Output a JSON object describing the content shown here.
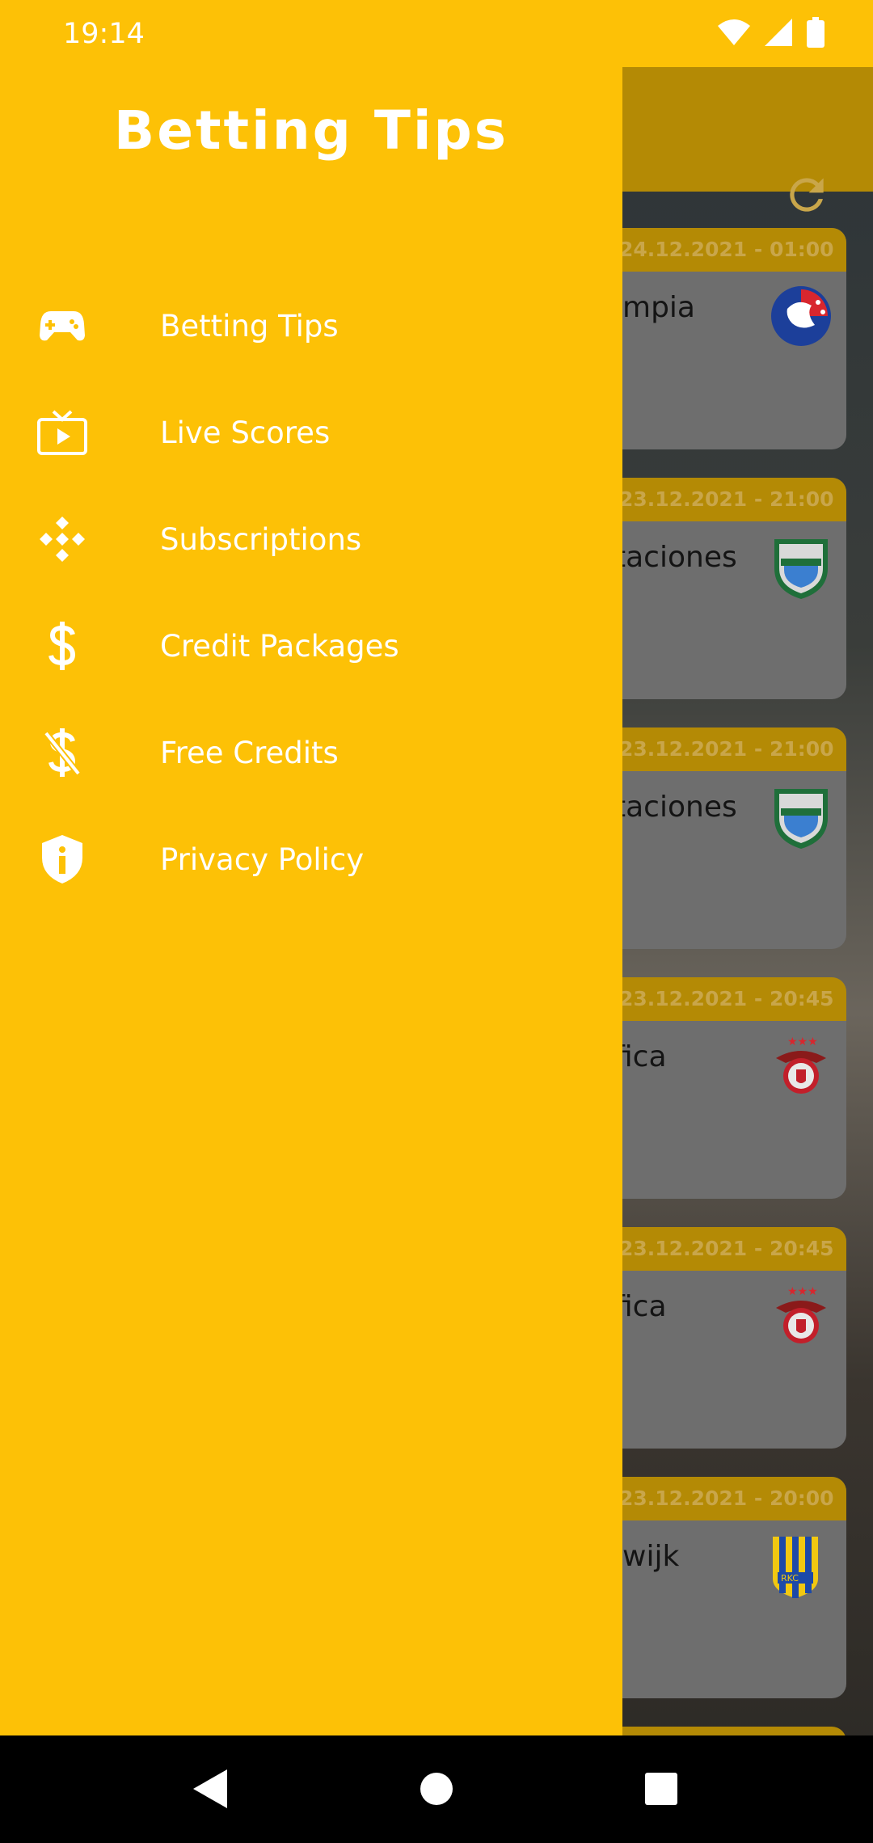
{
  "status_bar": {
    "time": "19:14",
    "icons": [
      "wifi-icon",
      "signal-icon",
      "battery-icon"
    ]
  },
  "drawer": {
    "title": "Betting Tips",
    "menu": [
      {
        "label": "Betting Tips",
        "icon": "gamepad-icon"
      },
      {
        "label": "Live Scores",
        "icon": "tv-icon"
      },
      {
        "label": "Subscriptions",
        "icon": "diamond-dots-icon"
      },
      {
        "label": "Credit Packages",
        "icon": "dollar-icon"
      },
      {
        "label": "Free Credits",
        "icon": "dollar-off-icon"
      },
      {
        "label": "Privacy Policy",
        "icon": "shield-info-icon"
      }
    ]
  },
  "background": {
    "toolbar_action": "refresh-icon",
    "matches": [
      {
        "date": "24.12.2021 - 01:00",
        "team": "impia",
        "logo": "club-badge-red-blue"
      },
      {
        "date": "23.12.2021 - 21:00",
        "team": "taciones",
        "logo": "club-badge-green-blue"
      },
      {
        "date": "23.12.2021 - 21:00",
        "team": "taciones",
        "logo": "club-badge-green-blue"
      },
      {
        "date": "23.12.2021 - 20:45",
        "team": "fica",
        "logo": "club-badge-eagle"
      },
      {
        "date": "23.12.2021 - 20:45",
        "team": "fica",
        "logo": "club-badge-eagle"
      },
      {
        "date": "23.12.2021 - 20:00",
        "team": "lwijk",
        "logo": "club-badge-rkc"
      }
    ]
  },
  "nav_bar": {
    "buttons": [
      "back-icon",
      "home-icon",
      "recents-icon"
    ]
  },
  "colors": {
    "accent": "#fdc106",
    "dim_accent": "#b48a05",
    "nav": "#000000"
  }
}
